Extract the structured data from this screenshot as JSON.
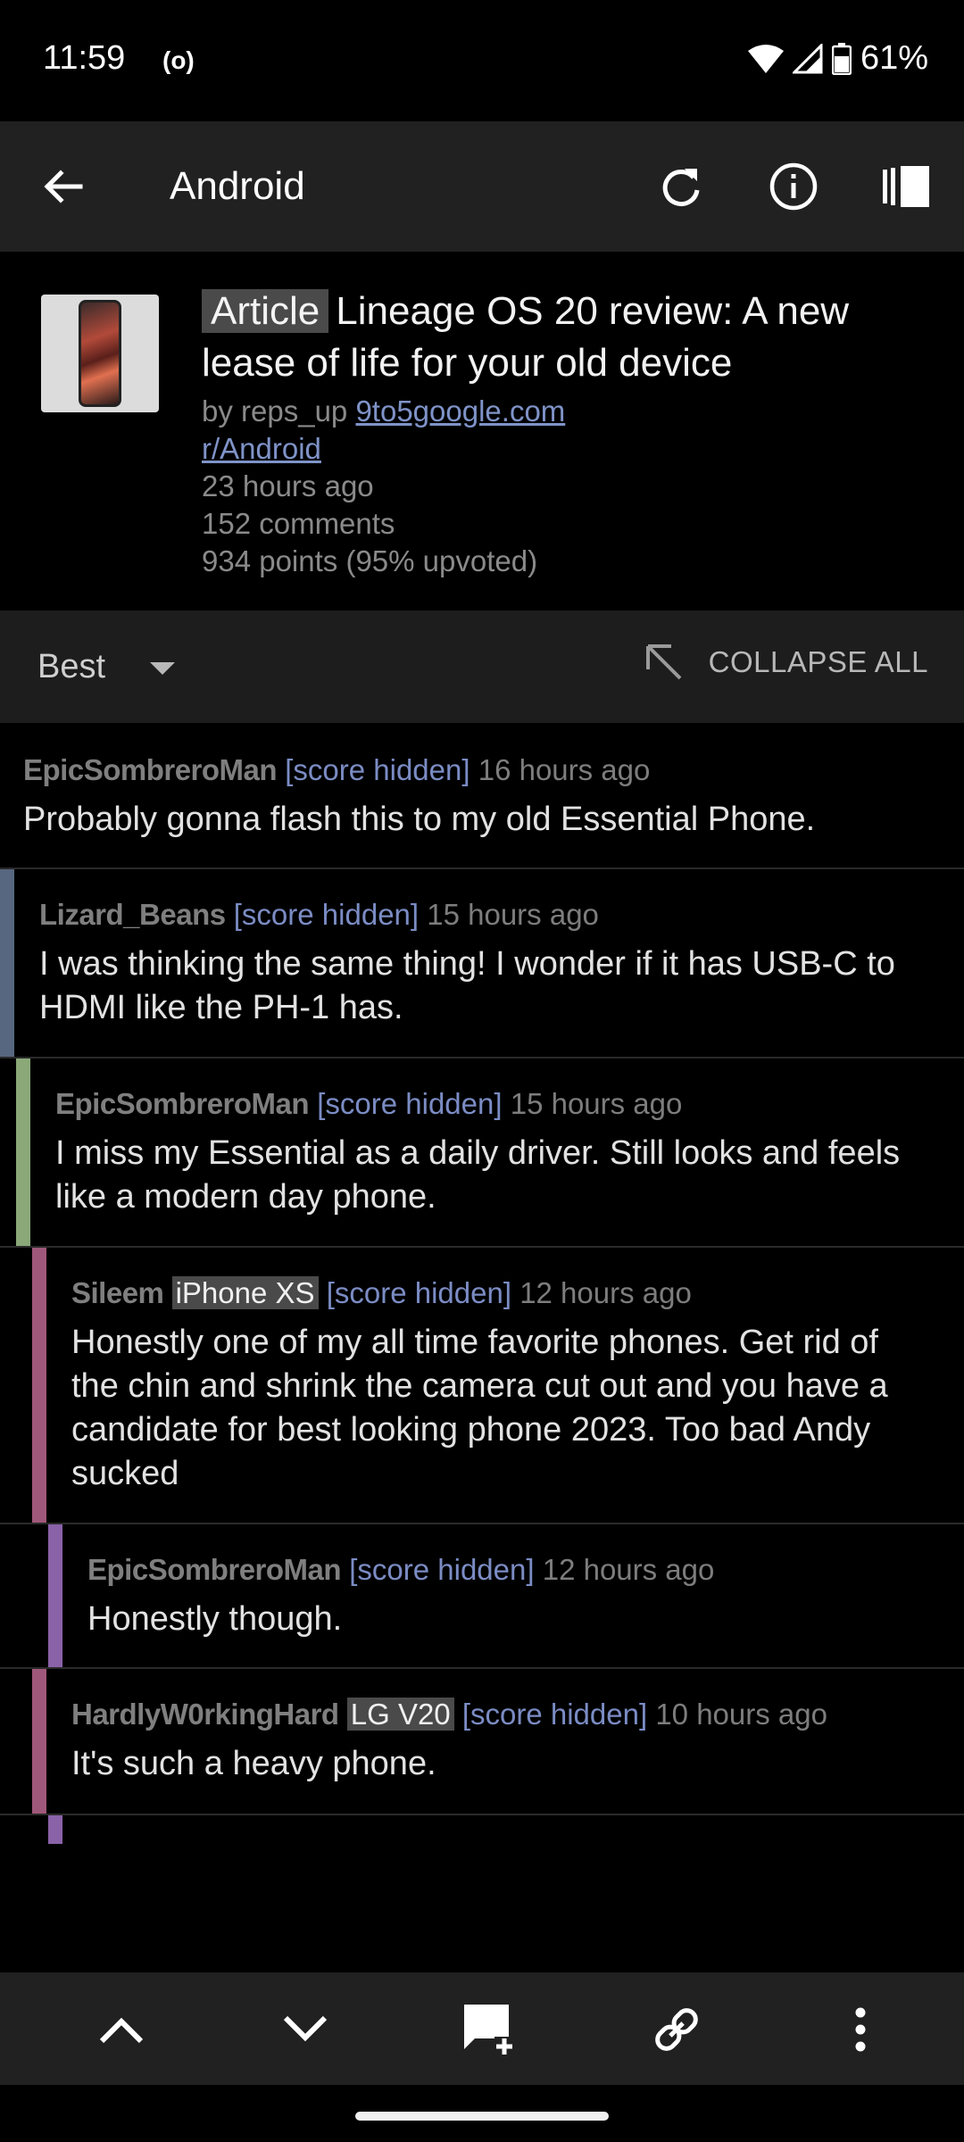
{
  "status": {
    "time": "11:59",
    "hotspot": "(o)",
    "battery": "61%"
  },
  "appbar": {
    "title": "Android"
  },
  "post": {
    "flair": "Article",
    "title": "Lineage OS 20 review: A new lease of life for your old device",
    "by": "by reps_up",
    "domain": "9to5google.com",
    "subreddit": "r/Android",
    "age": "23 hours ago",
    "comments": "152 comments",
    "points": "934 points (95% upvoted)"
  },
  "sortbar": {
    "sort": "Best",
    "collapse_label": "COLLAPSE ALL"
  },
  "comments": [
    {
      "author": "EpicSombreroMan",
      "flair": "",
      "score": "[score hidden]",
      "age": "16 hours ago",
      "body": "Probably gonna flash this to my old Essential Phone.",
      "depth": 0,
      "color": ""
    },
    {
      "author": "Lizard_Beans",
      "flair": "",
      "score": "[score hidden]",
      "age": "15 hours ago",
      "body": "I was thinking the same thing! I wonder if it has USB-C to HDMI like the PH-1 has.",
      "depth": 1,
      "color": "#56677f"
    },
    {
      "author": "EpicSombreroMan",
      "flair": "",
      "score": "[score hidden]",
      "age": "15 hours ago",
      "body": "I miss my Essential as a daily driver. Still looks and feels like a modern day phone.",
      "depth": 2,
      "color": "#8aa878"
    },
    {
      "author": "Sileem",
      "flair": "iPhone XS",
      "score": "[score hidden]",
      "age": "12 hours ago",
      "body": "Honestly one of my all time favorite phones. Get rid of the chin and shrink the camera cut out and you have a candidate for best looking phone 2023. Too bad Andy sucked",
      "depth": 3,
      "color": "#a0587a"
    },
    {
      "author": "EpicSombreroMan",
      "flair": "",
      "score": "[score hidden]",
      "age": "12 hours ago",
      "body": "Honestly though.",
      "depth": 4,
      "color": "#8a62a8"
    },
    {
      "author": "HardlyW0rkingHard",
      "flair": "LG V20",
      "score": "[score hidden]",
      "age": "10 hours ago",
      "body": "It's such a heavy phone.",
      "depth": 3,
      "color": "#a0587a"
    }
  ],
  "colors": {
    "link": "#7f93c8",
    "appbar": "#212121",
    "nested_more": "#8a62a8"
  },
  "icons": {
    "appbar": [
      "back-arrow-icon",
      "refresh-icon",
      "info-icon",
      "sidebar-icon"
    ],
    "bottomnav": [
      "chevron-up-icon",
      "chevron-down-icon",
      "add-comment-icon",
      "link-icon",
      "more-vert-icon"
    ]
  }
}
